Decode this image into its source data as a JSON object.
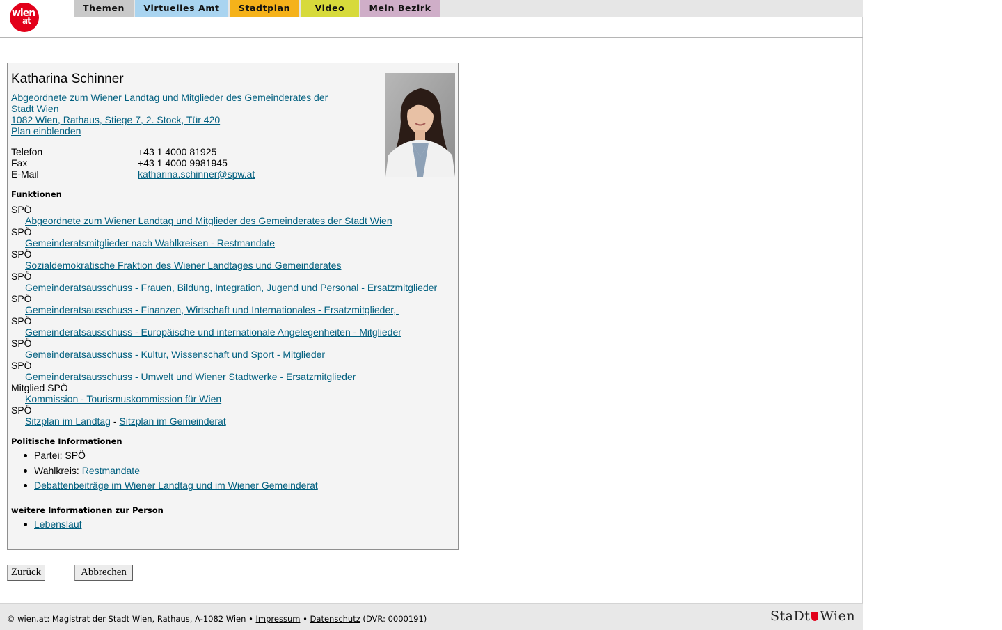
{
  "header": {
    "logo_text_top": "wien",
    "logo_text_bottom": "at",
    "nav": [
      {
        "label": "Themen",
        "color": "#c9c9c9"
      },
      {
        "label": "Virtuelles Amt",
        "color": "#a9d4f0"
      },
      {
        "label": "Stadtplan",
        "color": "#f5b21a"
      },
      {
        "label": "Video",
        "color": "#d7da3b"
      },
      {
        "label": "Mein Bezirk",
        "color": "#cfaec8"
      }
    ]
  },
  "person": {
    "name": "Katharina Schinner",
    "role_line1": "Abgeordnete zum Wiener Landtag und Mitglieder des Gemeinderates der",
    "role_line2": "Stadt Wien",
    "address": "1082 Wien, Rathaus, Stiege 7, 2. Stock, Tür 420",
    "plan_link": "Plan einblenden",
    "contacts": [
      {
        "label": "Telefon",
        "value": "+43 1 4000 81925"
      },
      {
        "label": "Fax",
        "value": "+43 1 4000 9981945"
      },
      {
        "label": "E-Mail",
        "value": "katharina.schinner@spw.at"
      }
    ]
  },
  "funktionen": {
    "heading": "Funktionen",
    "items": [
      {
        "party": "SPÖ",
        "link": "Abgeordnete zum Wiener Landtag und Mitglieder des Gemeinderates der Stadt Wien"
      },
      {
        "party": "SPÖ",
        "link": "Gemeinderatsmitglieder nach Wahlkreisen - Restmandate"
      },
      {
        "party": "SPÖ",
        "link": "Sozialdemokratische Fraktion des Wiener Landtages und Gemeinderates"
      },
      {
        "party": "SPÖ",
        "link": "Gemeinderatsausschuss - Frauen, Bildung, Integration, Jugend und Personal - Ersatzmitglieder"
      },
      {
        "party": "SPÖ",
        "link": "Gemeinderatsausschuss - Finanzen, Wirtschaft und Internationales - Ersatzmitglieder, "
      },
      {
        "party": "SPÖ",
        "link": "Gemeinderatsausschuss - Europäische und internationale Angelegenheiten - Mitglieder"
      },
      {
        "party": "SPÖ",
        "link": "Gemeinderatsausschuss - Kultur, Wissenschaft und Sport - Mitglieder"
      },
      {
        "party": "SPÖ",
        "link": "Gemeinderatsausschuss - Umwelt und Wiener Stadtwerke - Ersatzmitglieder"
      },
      {
        "party": "Mitglied SPÖ",
        "link": "Kommission - Tourismuskommission für Wien"
      }
    ],
    "last_party": "SPÖ",
    "sitzplan_landtag": "Sitzplan im Landtag",
    "sitzplan_sep": " - ",
    "sitzplan_gemeinderat": "Sitzplan im Gemeinderat"
  },
  "politisch": {
    "heading": "Politische Informationen",
    "partei": "Partei: SPÖ",
    "wahlkreis_label": "Wahlkreis: ",
    "wahlkreis_link": "Restmandate",
    "debatten": "Debattenbeiträge im Wiener Landtag und im Wiener Gemeinderat"
  },
  "weitere": {
    "heading": "weitere Informationen zur Person",
    "lebenslauf": "Lebenslauf"
  },
  "buttons": {
    "back": "Zurück",
    "cancel": "Abbrechen"
  },
  "footer": {
    "text": "© wien.at: Magistrat der Stadt Wien, Rathaus, A-1082 Wien • ",
    "impressum": "Impressum",
    "sep": " • ",
    "datenschutz": "Datenschutz",
    "dvr": " (DVR: 0000191)",
    "brand_left": "StaDt",
    "brand_right": "Wien"
  }
}
